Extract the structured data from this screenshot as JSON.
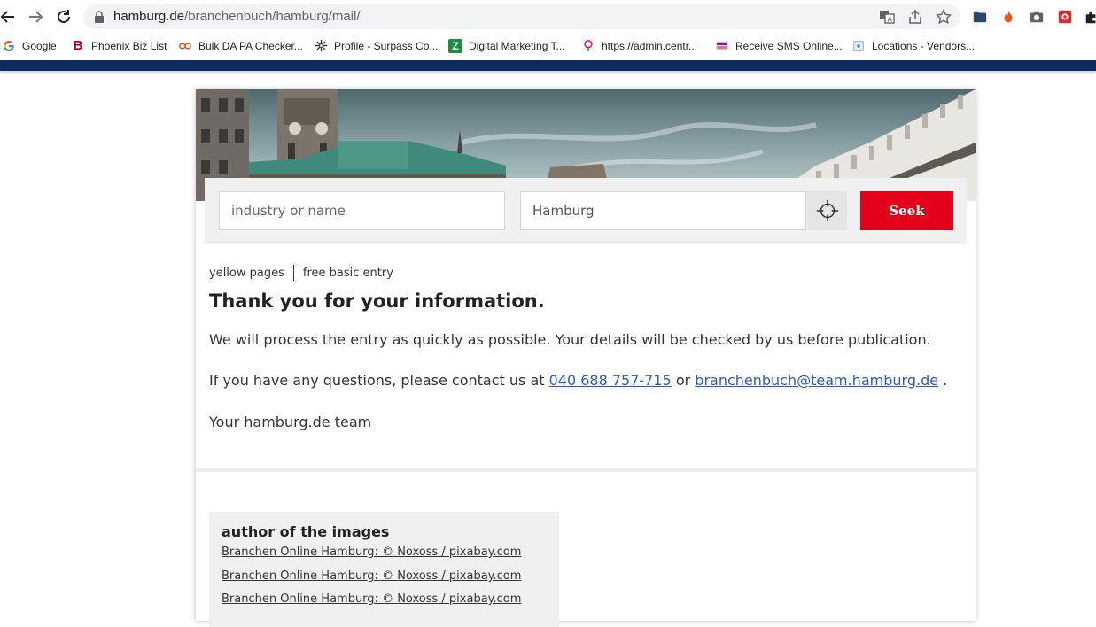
{
  "browser": {
    "url_host": "hamburg.de",
    "url_path": "/branchenbuch/hamburg/mail/",
    "bookmarks": [
      {
        "label": "Google",
        "icon": "google-icon"
      },
      {
        "label": "Phoenix Biz List",
        "icon": "B"
      },
      {
        "label": "Bulk DA PA Checker...",
        "icon": "link-icon"
      },
      {
        "label": "Profile - Surpass Co...",
        "icon": "asterisk-icon"
      },
      {
        "label": "Digital Marketing T...",
        "icon": "Z"
      },
      {
        "label": "https://admin.centr...",
        "icon": "pin-icon"
      },
      {
        "label": "Receive SMS Online...",
        "icon": "sms-icon"
      },
      {
        "label": "Locations - Vendors...",
        "icon": "page-icon"
      }
    ]
  },
  "search": {
    "query_placeholder": "industry or name",
    "location_value": "Hamburg",
    "submit_label": "Seek"
  },
  "breadcrumb": {
    "item1": "yellow pages",
    "item2": "free basic entry"
  },
  "content": {
    "title": "Thank you for your information.",
    "p1": "We will process the entry as quickly as possible. Your details will be checked by us before publication.",
    "p2_prefix": "If you have any questions, please contact us at",
    "phone": "040 688 757-715",
    "p2_or": "or",
    "email": "branchenbuch@team.hamburg.de",
    "p2_suffix": ".",
    "signoff": "Your hamburg.de team"
  },
  "credits": {
    "title": "author of the images",
    "links": [
      "Branchen Online Hamburg: © Noxoss / pixabay.com",
      "Branchen Online Hamburg: © Noxoss / pixabay.com",
      "Branchen Online Hamburg: © Noxoss / pixabay.com"
    ]
  },
  "colors": {
    "accent": "#e2001a",
    "topbar": "#0b2c5c",
    "link": "#2a5db0"
  }
}
